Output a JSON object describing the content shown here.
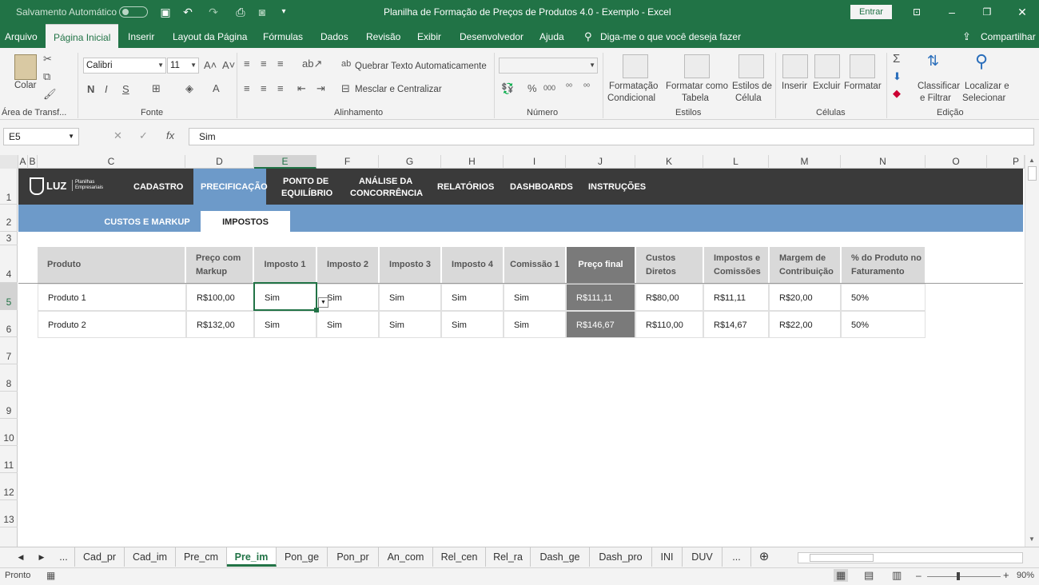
{
  "titlebar": {
    "autosave": "Salvamento Automático",
    "title": "Planilha de Formação de Preços de Produtos 4.0 - Exemplo - Excel",
    "signin": "Entrar"
  },
  "ribbon_tabs": [
    "Arquivo",
    "Página Inicial",
    "Inserir",
    "Layout da Página",
    "Fórmulas",
    "Dados",
    "Revisão",
    "Exibir",
    "Desenvolvedor",
    "Ajuda"
  ],
  "tellme": "Diga-me o que você deseja fazer",
  "share": "Compartilhar",
  "ribbon": {
    "clipboard": {
      "paste": "Colar",
      "group": "Área de Transf..."
    },
    "font": {
      "name": "Calibri",
      "size": "11",
      "bold": "N",
      "italic": "I",
      "underline": "S",
      "group": "Fonte"
    },
    "alignment": {
      "wrap": "Quebrar Texto Automaticamente",
      "merge": "Mesclar e Centralizar",
      "group": "Alinhamento"
    },
    "number": {
      "format": "",
      "group": "Número"
    },
    "styles": {
      "conditional1": "Formatação",
      "conditional2": "Condicional",
      "table1": "Formatar como",
      "table2": "Tabela",
      "cell1": "Estilos de",
      "cell2": "Célula",
      "group": "Estilos"
    },
    "cells": {
      "insert": "Inserir",
      "delete": "Excluir",
      "format": "Formatar",
      "group": "Células"
    },
    "editing": {
      "sort1": "Classificar",
      "sort2": "e Filtrar",
      "find1": "Localizar e",
      "find2": "Selecionar",
      "group": "Edição"
    }
  },
  "formula": {
    "namebox": "E5",
    "value": "Sim"
  },
  "columns": [
    "A",
    "B",
    "C",
    "D",
    "E",
    "F",
    "G",
    "H",
    "I",
    "J",
    "K",
    "L",
    "M",
    "N",
    "O",
    "P"
  ],
  "rows": [
    "1",
    "2",
    "3",
    "4",
    "5",
    "6",
    "7",
    "8",
    "9",
    "10",
    "11",
    "12",
    "13"
  ],
  "nav": {
    "logo": "LUZ",
    "logo_sub1": "Planilhas",
    "logo_sub2": "Empresariais",
    "items": [
      "CADASTRO",
      "PRECIFICAÇÃO",
      "PONTO DE",
      "EQUILÍBRIO",
      "ANÁLISE DA",
      "CONCORRÊNCIA",
      "RELATÓRIOS",
      "DASHBOARDS",
      "INSTRUÇÕES"
    ]
  },
  "subnav": [
    "CUSTOS E MARKUP",
    "IMPOSTOS"
  ],
  "table": {
    "headers": [
      "Produto",
      "Preço com",
      "Markup",
      "Imposto 1",
      "Imposto 2",
      "Imposto 3",
      "Imposto 4",
      "Comissão 1",
      "Preço final",
      "Custos",
      "Diretos",
      "Impostos e",
      "Comissões",
      "Margem de",
      "Contribuição",
      "% do Produto no",
      "Faturamento"
    ],
    "rows": [
      [
        "Produto 1",
        "R$100,00",
        "Sim",
        "Sim",
        "Sim",
        "Sim",
        "Sim",
        "R$111,11",
        "R$80,00",
        "R$11,11",
        "R$20,00",
        "50%"
      ],
      [
        "Produto 2",
        "R$132,00",
        "Sim",
        "Sim",
        "Sim",
        "Sim",
        "Sim",
        "R$146,67",
        "R$110,00",
        "R$14,67",
        "R$22,00",
        "50%"
      ]
    ]
  },
  "sheet_tabs": [
    "...",
    "Cad_pr",
    "Cad_im",
    "Pre_cm",
    "Pre_im",
    "Pon_ge",
    "Pon_pr",
    "An_com",
    "Rel_cen",
    "Rel_ra",
    "Dash_ge",
    "Dash_pro",
    "INI",
    "DUV",
    "..."
  ],
  "status": {
    "ready": "Pronto",
    "zoom": "90%"
  }
}
